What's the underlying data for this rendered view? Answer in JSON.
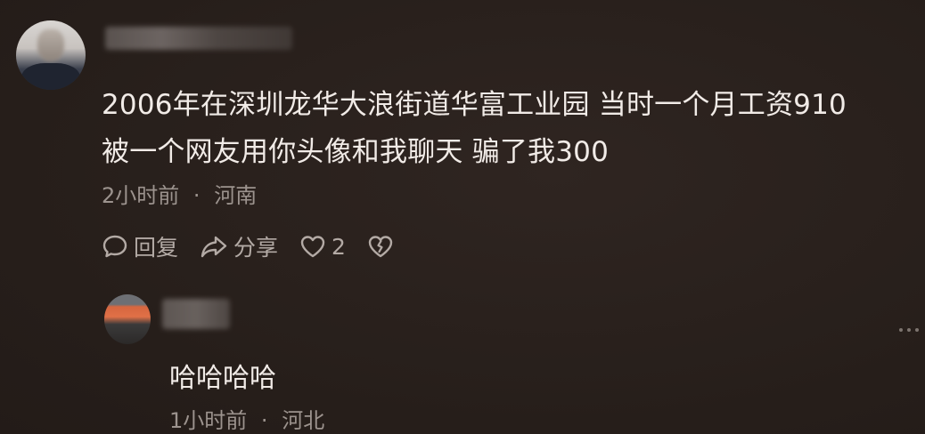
{
  "comment": {
    "line1": "2006年在深圳龙华大浪街道华富工业园 当时一个月工资910",
    "line2": "被一个网友用你头像和我聊天 骗了我300",
    "time": "2小时前",
    "separator": "·",
    "location": "河南",
    "actions": {
      "reply_label": "回复",
      "share_label": "分享",
      "like_count": "2"
    }
  },
  "reply": {
    "text": "哈哈哈哈",
    "time": "1小时前",
    "separator": "·",
    "location": "河北"
  },
  "icons": {
    "reply": "speech-bubble-icon",
    "share": "share-arrow-icon",
    "like": "heart-icon",
    "dislike": "broken-heart-icon",
    "more": "more-dots-icon"
  },
  "colors": {
    "background": "#2a211d",
    "text": "#f1ebe7",
    "meta": "#9c938e",
    "action": "#b3aaa5"
  }
}
